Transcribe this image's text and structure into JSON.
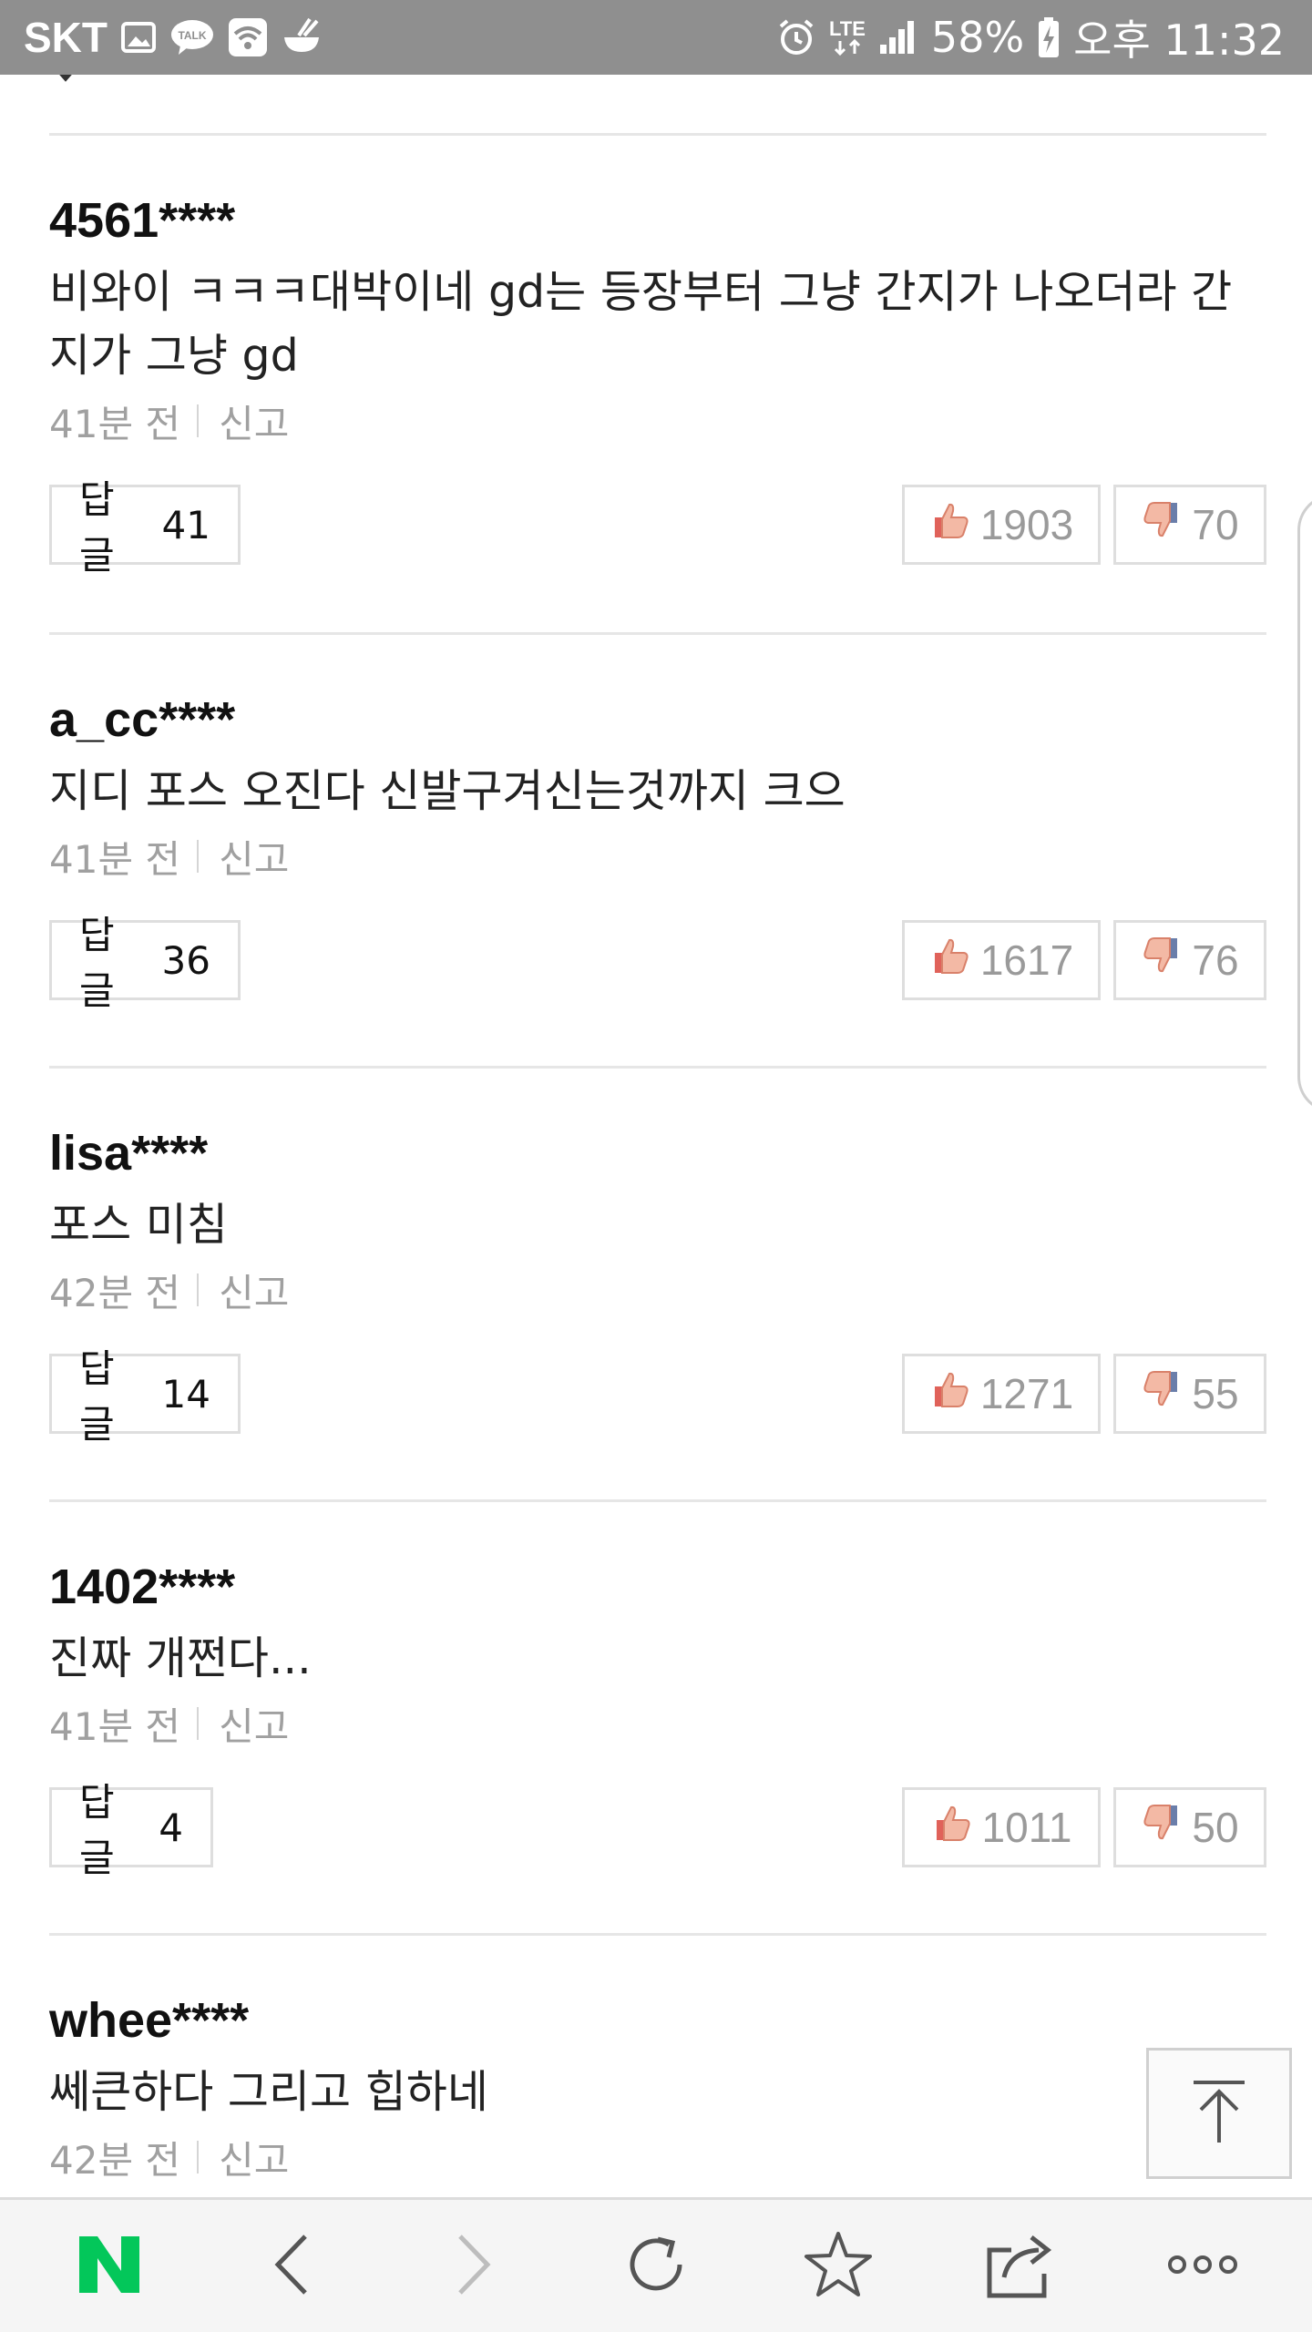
{
  "status_bar": {
    "carrier": "SKT",
    "network": "LTE",
    "battery": "58%",
    "time": "오후 11:32",
    "icons": [
      "gallery-icon",
      "talk-icon",
      "wifi-icon",
      "bowl-icon",
      "alarm-icon",
      "lte-icon",
      "signal-icon",
      "battery-charging-icon"
    ]
  },
  "comments": [
    {
      "user": "4561****",
      "text": "비와이 ㅋㅋㅋ대박이네 gd는 등장부터 그냥 간지가 나오더라 간지가 그냥 gd",
      "time": "41분 전",
      "report": "신고",
      "reply_label": "답글",
      "reply_count": "41",
      "likes": "1903",
      "dislikes": "70"
    },
    {
      "user": "a_cc****",
      "text": "지디 포스 오진다 신발구겨신는것까지 크으",
      "time": "41분 전",
      "report": "신고",
      "reply_label": "답글",
      "reply_count": "36",
      "likes": "1617",
      "dislikes": "76"
    },
    {
      "user": "lisa****",
      "text": "포스 미침",
      "time": "42분 전",
      "report": "신고",
      "reply_label": "답글",
      "reply_count": "14",
      "likes": "1271",
      "dislikes": "55"
    },
    {
      "user": "1402****",
      "text": "진짜 개쩐다...",
      "time": "41분 전",
      "report": "신고",
      "reply_label": "답글",
      "reply_count": "4",
      "likes": "1011",
      "dislikes": "50"
    },
    {
      "user": "whee****",
      "text": "쎄큰하다 그리고 힙하네",
      "time": "42분 전",
      "report": "신고"
    }
  ],
  "bottom_bar": {
    "items": [
      "naver-home-icon",
      "back-icon",
      "forward-icon",
      "refresh-icon",
      "bookmark-star-icon",
      "share-icon",
      "more-icon"
    ],
    "brand_color": "#03c75a"
  }
}
